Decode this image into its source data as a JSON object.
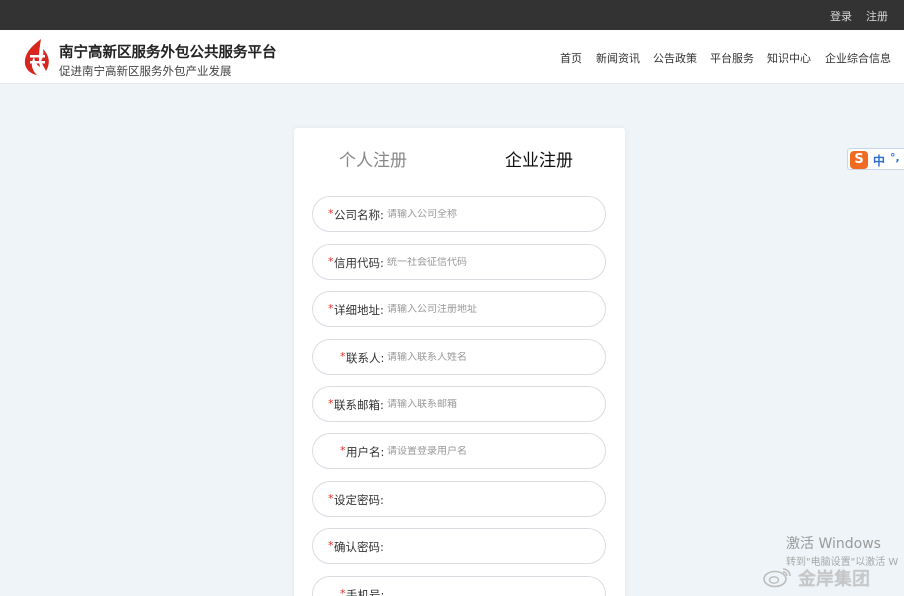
{
  "topbar": {
    "login": "登录",
    "register": "注册"
  },
  "header": {
    "title": "南宁高新区服务外包公共服务平台",
    "subtitle": "促进南宁高新区服务外包产业发展",
    "logo_icon": "stylized-red-flame-logo",
    "nav": [
      "首页",
      "新闻资讯",
      "公告政策",
      "平台服务",
      "知识中心",
      "企业综合信息"
    ]
  },
  "tabs": {
    "personal": "个人注册",
    "company": "企业注册",
    "active": "company"
  },
  "form": {
    "required_mark": "*",
    "fields": [
      {
        "label": "公司名称:",
        "placeholder": "请输入公司全称"
      },
      {
        "label": "信用代码:",
        "placeholder": "统一社会征信代码"
      },
      {
        "label": "详细地址:",
        "placeholder": "请输入公司注册地址"
      },
      {
        "label": "联系人:",
        "placeholder": "请输入联系人姓名"
      },
      {
        "label": "联系邮箱:",
        "placeholder": "请输入联系邮箱"
      },
      {
        "label": "用户名:",
        "placeholder": "请设置登录用户名"
      },
      {
        "label": "设定密码:",
        "placeholder": ""
      },
      {
        "label": "确认密码:",
        "placeholder": ""
      },
      {
        "label": "手机号:",
        "placeholder": ""
      }
    ]
  },
  "ime": {
    "logo": "S",
    "mode": "中",
    "punct": "°,"
  },
  "overlay": {
    "activate_title": "激活 Windows",
    "activate_hint": "转到\"电脑设置\"以激活 W",
    "watermark": "金岸集团",
    "watermark_icon": "weibo-icon"
  },
  "colors": {
    "topbar_bg": "#333333",
    "page_bg": "#eef4f8",
    "required": "#e0302b",
    "logo_red": "#d7261e"
  }
}
